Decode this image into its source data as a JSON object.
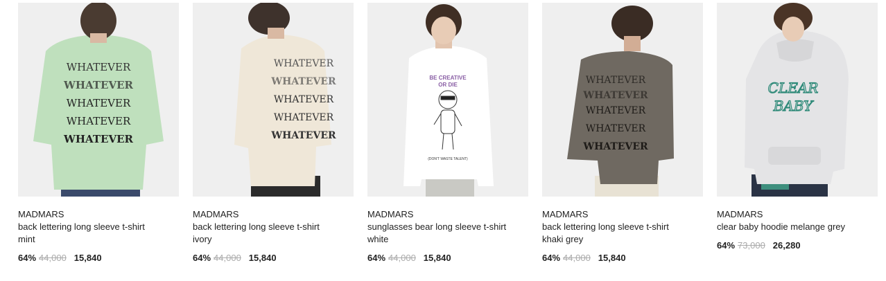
{
  "products": [
    {
      "brand": "MADMARS",
      "title_line1": "back lettering long sleeve t-shirt",
      "title_line2": "mint",
      "discount": "64%",
      "original_price": "44,000",
      "sale_price": "15,840",
      "shirt_color": "#bfe0bd",
      "print_text": [
        "WHATEVER",
        "WHATEVER",
        "WHATEVER",
        "WHATEVER",
        "WHATEVER"
      ]
    },
    {
      "brand": "MADMARS",
      "title_line1": "back lettering long sleeve t-shirt",
      "title_line2": "ivory",
      "discount": "64%",
      "original_price": "44,000",
      "sale_price": "15,840",
      "shirt_color": "#efe7d8",
      "print_text": [
        "WHATEVER",
        "WHATEVER",
        "WHATEVER",
        "WHATEVER",
        "WHATEVER"
      ]
    },
    {
      "brand": "MADMARS",
      "title_line1": "sunglasses bear long sleeve t-shirt",
      "title_line2": "white",
      "discount": "64%",
      "original_price": "44,000",
      "sale_price": "15,840",
      "shirt_color": "#ffffff",
      "print_text": [
        "BE CREATIVE",
        "OR DIE",
        "(DON'T WASTE TALENT)"
      ]
    },
    {
      "brand": "MADMARS",
      "title_line1": "back lettering long sleeve t-shirt",
      "title_line2": "khaki grey",
      "discount": "64%",
      "original_price": "44,000",
      "sale_price": "15,840",
      "shirt_color": "#6f6961",
      "print_text": [
        "WHATEVER",
        "WHATEVER",
        "WHATEVER",
        "WHATEVER",
        "WHATEVER"
      ]
    },
    {
      "brand": "MADMARS",
      "title_line1": "clear baby hoodie melange grey",
      "title_line2": "",
      "discount": "64%",
      "original_price": "73,000",
      "sale_price": "26,280",
      "shirt_color": "#e4e4e6",
      "print_text": [
        "CLEAR",
        "BABY"
      ]
    }
  ]
}
